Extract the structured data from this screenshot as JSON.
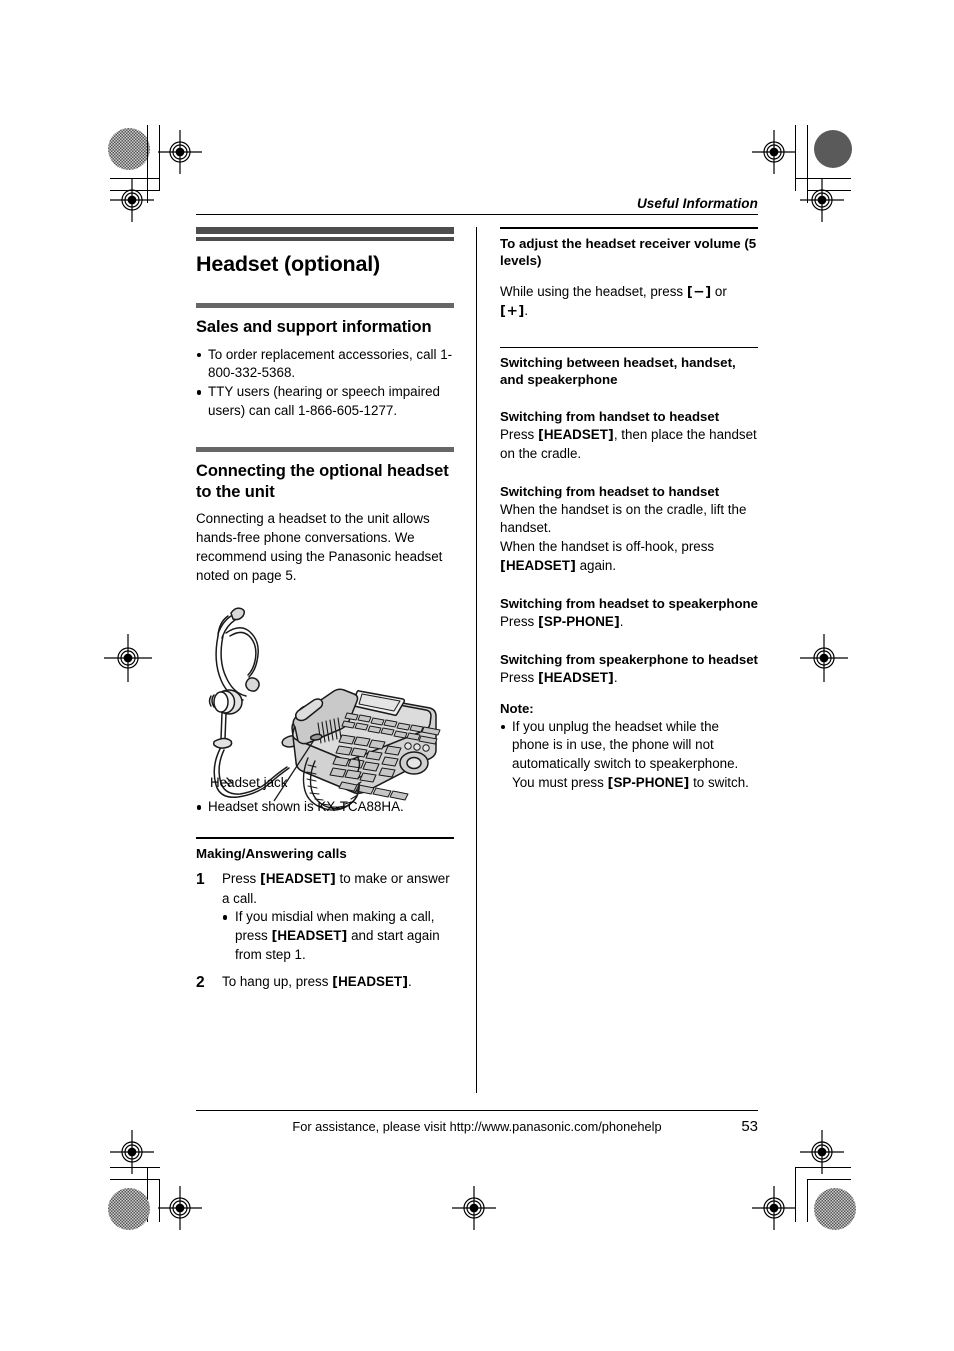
{
  "running_head": "Useful Information",
  "left_column": {
    "chapter_title": "Headset (optional)",
    "sales": {
      "heading": "Sales and support information",
      "bullets": [
        "To order replacement accessories, call 1-800-332-5368.",
        "TTY users (hearing or speech impaired users) can call 1-866-605-1277."
      ]
    },
    "connecting": {
      "heading": "Connecting the optional headset to the unit",
      "body": "Connecting a headset to the unit allows hands-free phone conversations. We recommend using the Panasonic headset noted on page 5.",
      "figure_label": "Headset jack",
      "figure_note": "Headset shown is KX-TCA88HA."
    },
    "making": {
      "heading": "Making/Answering calls",
      "step1_num": "1",
      "step1_pre": "Press ",
      "step1_key": "HEADSET",
      "step1_post": " to make or answer a call.",
      "step1_bullet_pre": "If you misdial when making a call, press ",
      "step1_bullet_key": "HEADSET",
      "step1_bullet_post": " and start again from step 1.",
      "step2_num": "2",
      "step2_pre": "To hang up, press ",
      "step2_key": "HEADSET",
      "step2_post": "."
    }
  },
  "right_column": {
    "volume": {
      "heading": "To adjust the headset receiver volume (5 levels)",
      "body_pre": "While using the headset, press ",
      "key_minus": "−",
      "body_mid": " or ",
      "key_plus": "+",
      "body_post": "."
    },
    "switching": {
      "heading": "Switching between headset, handset, and speakerphone",
      "items": [
        {
          "title": "Switching from handset to headset",
          "pre": "Press ",
          "key": "HEADSET",
          "post": ", then place the handset on the cradle."
        },
        {
          "title": "Switching from headset to handset",
          "pre": "When the handset is on the cradle, lift the handset.\nWhen the handset is off-hook, press ",
          "key": "HEADSET",
          "post": " again."
        },
        {
          "title": "Switching from headset to speakerphone",
          "pre": "Press ",
          "key": "SP-PHONE",
          "post": "."
        },
        {
          "title": "Switching from speakerphone to headset",
          "pre": "Press ",
          "key": "HEADSET",
          "post": "."
        }
      ]
    },
    "note": {
      "label": "Note:",
      "pre": "If you unplug the headset while the phone is in use, the phone will not automatically switch to speakerphone. You must press ",
      "key": "SP-PHONE",
      "post": " to switch."
    }
  },
  "footer": {
    "text": "For assistance, please visit http://www.panasonic.com/phonehelp",
    "page_number": "53"
  }
}
